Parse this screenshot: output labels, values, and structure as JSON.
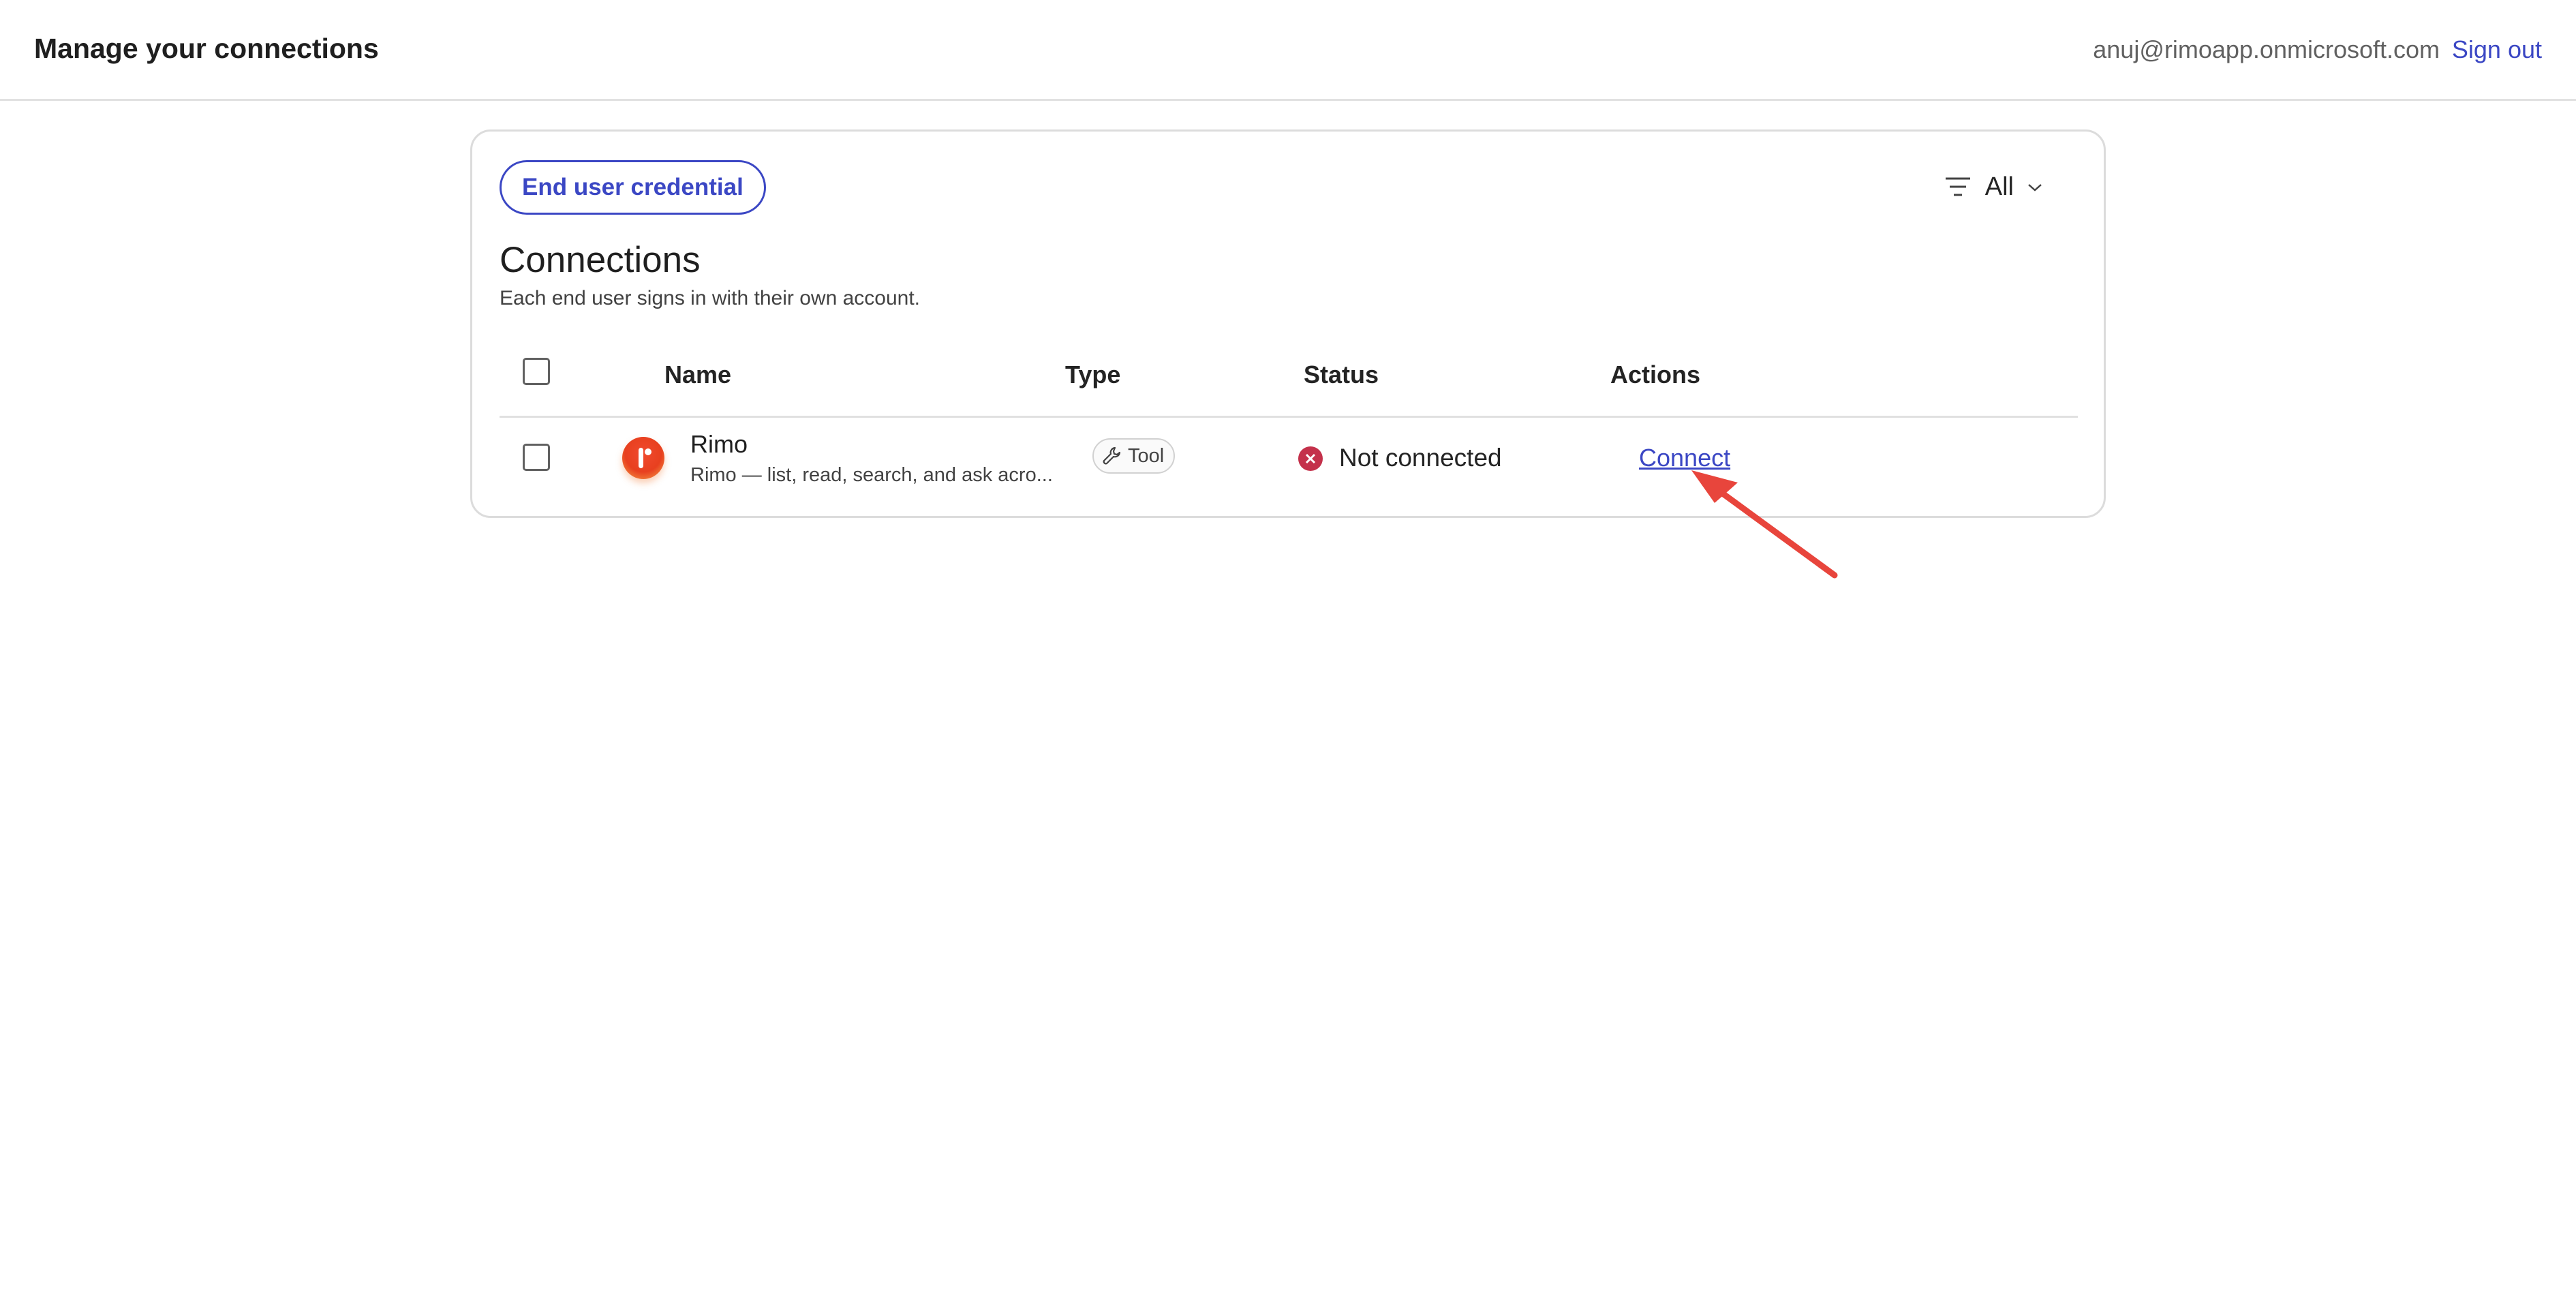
{
  "header": {
    "title": "Manage your connections",
    "user_email": "anuj@rimoapp.onmicrosoft.com",
    "sign_out_label": "Sign out"
  },
  "toolbar": {
    "credential_button": "End user credential",
    "filter_label": "All",
    "filter_icon": "filter-icon",
    "filter_chevron": "chevron-down-icon"
  },
  "section": {
    "title": "Connections",
    "subtitle": "Each end user signs in with their own account."
  },
  "table": {
    "columns": {
      "name": "Name",
      "type": "Type",
      "status": "Status",
      "actions": "Actions"
    },
    "rows": [
      {
        "name": "Rimo",
        "description": "Rimo — list, read, search, and ask acro...",
        "logo_icon": "rimo-logo-icon",
        "type": "Tool",
        "type_icon": "wrench-icon",
        "status": "Not connected",
        "status_icon": "error-circle-icon",
        "action": "Connect"
      }
    ]
  },
  "colors": {
    "accent": "#3b47c4",
    "error": "#c4314b",
    "annotation": "#e8453c"
  }
}
